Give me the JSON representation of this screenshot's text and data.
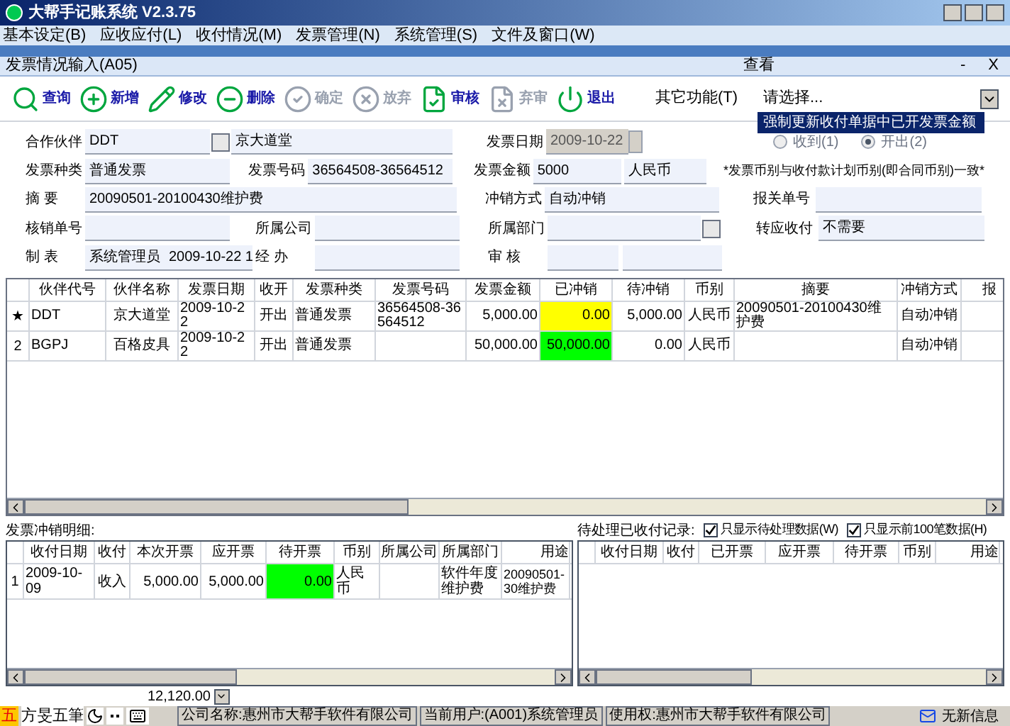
{
  "window": {
    "title": "大帮手记账系统 V2.3.75"
  },
  "menu": [
    "基本设定(B)",
    "应收应付(L)",
    "收付情况(M)",
    "发票管理(N)",
    "系统管理(S)",
    "文件及窗口(W)"
  ],
  "child_window": {
    "title": "发票情况输入(A05)",
    "caption": "查看",
    "minimize": "-",
    "close": "X"
  },
  "toolbar": [
    {
      "kind": "search",
      "label": "查询",
      "disabled": false
    },
    {
      "kind": "add",
      "label": "新增",
      "disabled": false
    },
    {
      "kind": "edit",
      "label": "修改",
      "disabled": false
    },
    {
      "kind": "delete",
      "label": "删除",
      "disabled": false
    },
    {
      "kind": "confirm",
      "label": "确定",
      "disabled": true
    },
    {
      "kind": "cancel",
      "label": "放弃",
      "disabled": true
    },
    {
      "kind": "approve",
      "label": "审核",
      "disabled": false
    },
    {
      "kind": "unapprove",
      "label": "弃审",
      "disabled": true
    },
    {
      "kind": "exit",
      "label": "退出",
      "disabled": false
    }
  ],
  "other_functions": {
    "label": "其它功能(T)",
    "value": "请选择...",
    "option": "强制更新收付单据中已开发票金额"
  },
  "form": {
    "partner": {
      "label": "合作伙伴",
      "code": "DDT",
      "name": "京大道堂"
    },
    "invoice_date": {
      "label": "发票日期",
      "value": "2009-10-22",
      "disabled": true
    },
    "direction": [
      {
        "label": "收到(1)",
        "selected": false
      },
      {
        "label": "开出(2)",
        "selected": true
      }
    ],
    "invoice_type": {
      "label": "发票种类",
      "value": "普通发票"
    },
    "invoice_number": {
      "label": "发票号码",
      "value": "36564508-36564512"
    },
    "amount": {
      "label": "发票金额",
      "value": "5000",
      "currency": "人民币"
    },
    "note": "*发票币别与收付款计划币别(即合同币别)一致*",
    "summary": {
      "label": "摘 要",
      "value": "20090501-20100430维护费"
    },
    "offset_method": {
      "label": "冲销方式",
      "value": "自动冲销"
    },
    "customs_number": {
      "label": "报关单号"
    },
    "verification_number": {
      "label": "核销单号"
    },
    "company": {
      "label": "所属公司"
    },
    "department": {
      "label": "所属部门"
    },
    "transfer": {
      "label": "转应收付",
      "value": "不需要"
    },
    "creator": {
      "label": "制 表",
      "name": "系统管理员",
      "date": "2009-10-22 1"
    },
    "handler": {
      "label": "经 办"
    },
    "reviewer": {
      "label": "审 核"
    }
  },
  "main_table": {
    "columns": [
      "伙伴代号",
      "伙伴名称",
      "发票日期",
      "收开",
      "发票种类",
      "发票号码",
      "发票金额",
      "已冲销",
      "待冲销",
      "币别",
      "摘要",
      "冲销方式",
      "报"
    ],
    "rows": [
      {
        "marker": "★",
        "color": "#ffff00",
        "cells": [
          "DDT",
          "京大道堂",
          "2009-10-22",
          "开出",
          "普通发票",
          "36564508-36564512",
          "5,000.00",
          "0.00",
          "5,000.00",
          "人民币",
          "20090501-20100430维护费",
          "自动冲销",
          ""
        ]
      },
      {
        "marker": "2",
        "color": "#00ff00",
        "cells": [
          "BGPJ",
          "百格皮具",
          "2009-10-22",
          "开出",
          "普通发票",
          "",
          "50,000.00",
          "50,000.00",
          "0.00",
          "人民币",
          "",
          "自动冲销",
          ""
        ]
      }
    ]
  },
  "detail": {
    "title": "发票冲销明细:",
    "columns": [
      "收付日期",
      "收付",
      "本次开票",
      "应开票",
      "待开票",
      "币别",
      "所属公司",
      "所属部门",
      "用途"
    ],
    "rows": [
      {
        "marker": "1",
        "color": "#00ff00",
        "cells": [
          "2009-10-09",
          "收入",
          "5,000.00",
          "5,000.00",
          "0.00",
          "人民币",
          "",
          "软件年度维护费",
          ""
        ],
        "purpose_lines": [
          "20090501-",
          "30维护费"
        ]
      }
    ]
  },
  "pending": {
    "title": "待处理已收付记录:",
    "checkboxes": [
      {
        "label": "只显示待处理数据(W)",
        "checked": true
      },
      {
        "label": "只显示前100笔数据(H)",
        "checked": true
      }
    ],
    "columns": [
      "收付日期",
      "收付",
      "已开票",
      "应开票",
      "待开票",
      "币别",
      "用途"
    ]
  },
  "total": "12,120.00",
  "status_bar": {
    "ime": [
      "五",
      "方旻五筆"
    ],
    "segments": [
      "公司名称:惠州市大帮手软件有限公司",
      "当前用户:(A001)系统管理员",
      "使用权:惠州市大帮手软件有限公司"
    ],
    "messages": "无新信息"
  }
}
